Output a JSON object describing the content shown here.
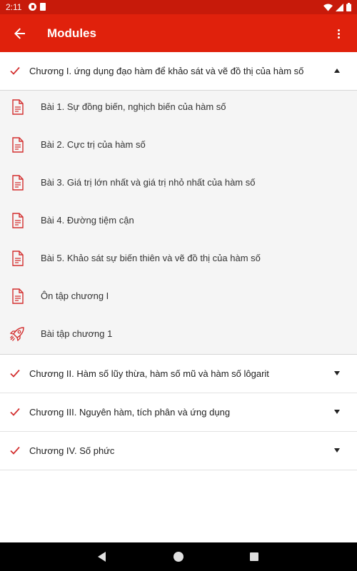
{
  "status_bar": {
    "time": "2:11",
    "icons": [
      "notification-app-icon",
      "sd-card-icon",
      "wifi-icon",
      "signal-icon",
      "battery-icon"
    ]
  },
  "app_bar": {
    "title": "Modules",
    "back_icon": "arrow-back-icon",
    "menu_icon": "more-vert-icon"
  },
  "colors": {
    "app_bar": "#e0210c",
    "status_bar": "#c71a0a",
    "accent": "#d32f2f",
    "lesson_background": "#f5f5f5"
  },
  "chapters": [
    {
      "label": "Chương I.  ứng dụng đạo hàm để khảo sát và vẽ đồ thị của hàm số",
      "expanded": true,
      "lessons": [
        {
          "label": "Bài 1. Sự đồng biến, nghịch biến của hàm số",
          "icon": "document-icon"
        },
        {
          "label": "Bài 2. Cực trị của hàm số",
          "icon": "document-icon"
        },
        {
          "label": "Bài 3. Giá trị lớn nhất và giá trị nhỏ nhất của hàm số",
          "icon": "document-icon"
        },
        {
          "label": "Bài 4. Đường tiệm cận",
          "icon": "document-icon"
        },
        {
          "label": "Bài 5. Khảo sát sự biến thiên và vẽ đồ thị của hàm số",
          "icon": "document-icon"
        },
        {
          "label": "Ôn tập chương I",
          "icon": "document-icon"
        },
        {
          "label": "Bài tập chương 1",
          "icon": "rocket-icon"
        }
      ]
    },
    {
      "label": "Chương II. Hàm số lũy thừa, hàm số mũ và hàm số lôgarit",
      "expanded": false
    },
    {
      "label": "Chương III. Nguyên hàm, tích phân và ứng dụng",
      "expanded": false
    },
    {
      "label": "Chương IV. Số phức",
      "expanded": false
    }
  ]
}
